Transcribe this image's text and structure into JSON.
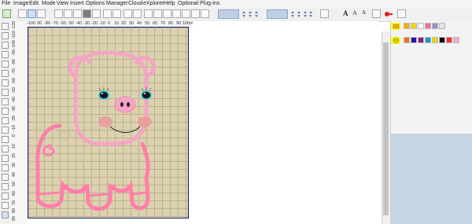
{
  "menu": [
    "File",
    "Image",
    "Edit",
    "Mode",
    "View",
    "Insert",
    "Options",
    "Manager",
    "Cloud",
    "eXplorer",
    "Help",
    "Optional Plug-ins"
  ],
  "ruler": {
    "h_ticks": [
      "-100",
      "90",
      "-80",
      "-70",
      "-60",
      "-50",
      "-40",
      "-30",
      "-20",
      "-10",
      "0",
      "10",
      "20",
      "30",
      "40",
      "50",
      "60",
      "70",
      "80",
      "90",
      "100"
    ],
    "h_unit": "millimeters",
    "v_ticks": [
      "-120",
      "-110",
      "-100",
      "-90",
      "-80",
      "-70",
      "-60",
      "-50",
      "-40",
      "-30",
      "-20",
      "-10",
      "0",
      "10",
      "20",
      "30",
      "40",
      "50",
      "60",
      "70",
      "80",
      "90"
    ]
  },
  "toolbar_text": {
    "a1": "A",
    "a2": "A",
    "a3": "A"
  },
  "colors": {
    "pink_outline": "#f5a5c4",
    "pink_body": "#ff7fa9",
    "cheek": "#e89a9a",
    "eye_teal": "#2ec6d1",
    "canvas_bg": "#dcd2b0",
    "grid": "#bcb28f",
    "canvas_border": "#1c1d7e",
    "thread_panel": "#c6d5e2"
  },
  "palette_row1": [
    "#f2a900",
    "#f5d800",
    "#ffffff",
    "#f06fa0",
    "#9b8fc7",
    "#e4e4e4"
  ],
  "palette_row2": [
    "#f37021",
    "#1a1aa6",
    "#8a1d86",
    "#00a0c6",
    "#ffd000",
    "#000000",
    "#ff2d2d",
    "#f7a8c4"
  ],
  "icons": [
    "arrow-select-icon",
    "zoom-icon",
    "rotate-icon",
    "circle-icon",
    "square-icon",
    "thread-spool-icon",
    "pig-face-icon"
  ]
}
